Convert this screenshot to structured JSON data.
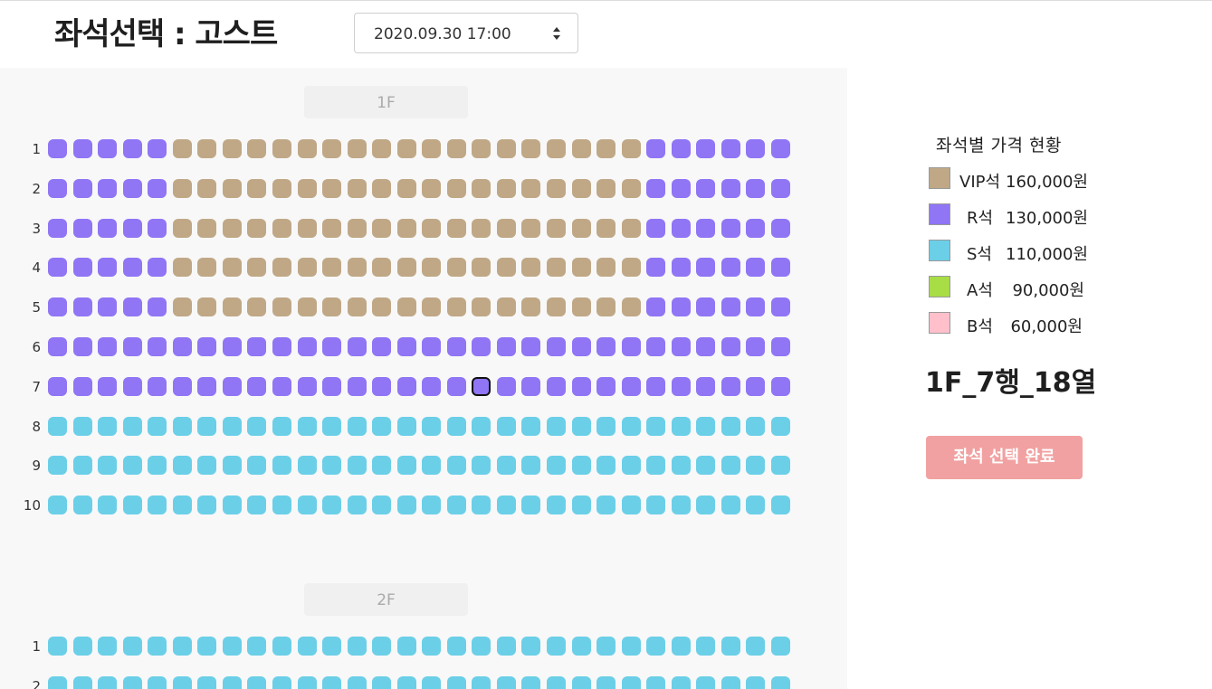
{
  "header": {
    "title": "좌석선택 : 고스트",
    "date_select": {
      "value": "2020.09.30 17:00",
      "icon": "sort-arrows-icon"
    }
  },
  "floors": [
    {
      "label": "1F",
      "rows": [
        {
          "label": "1",
          "seats": "RRRRRVVVVVVVVVVVVVVVVVVVRRRRRR"
        },
        {
          "label": "2",
          "seats": "RRRRRVVVVVVVVVVVVVVVVVVVRRRRRR"
        },
        {
          "label": "3",
          "seats": "RRRRRVVVVVVVVVVVVVVVVVVVRRRRRR"
        },
        {
          "label": "4",
          "seats": "RRRRRVVVVVVVVVVVVVVVVVVVRRRRRR"
        },
        {
          "label": "5",
          "seats": "RRRRRVVVVVVVVVVVVVVVVVVVRRRRRR"
        },
        {
          "label": "6",
          "seats": "RRRRRRRRRRRRRRRRRRRRRRRRRRRRRR"
        },
        {
          "label": "7",
          "seats": "RRRRRRRRRRRRRRRRRRRRRRRRRRRRRR",
          "selected_seat": 18
        },
        {
          "label": "8",
          "seats": "SSSSSSSSSSSSSSSSSSSSSSSSSSSSSS"
        },
        {
          "label": "9",
          "seats": "SSSSSSSSSSSSSSSSSSSSSSSSSSSSSS"
        },
        {
          "label": "10",
          "seats": "SSSSSSSSSSSSSSSSSSSSSSSSSSSSSS"
        }
      ]
    },
    {
      "label": "2F",
      "rows": [
        {
          "label": "1",
          "seats": "SSSSSSSSSSSSSSSSSSSSSSSSSSSSSS"
        },
        {
          "label": "2",
          "seats": "SSSSSSSSSSSSSSSSSSSSSSSSSSSSSS"
        }
      ]
    }
  ],
  "seat_colors": {
    "V": "#c0a886",
    "R": "#9075f5",
    "S": "#6bcfe8",
    "A": "#a8dd45",
    "B": "#ffc0cb"
  },
  "legend": {
    "title": "좌석별 가격 현황",
    "items": [
      {
        "grade": "VIP석",
        "price": "160,000원",
        "color": "#c0a886"
      },
      {
        "grade": "R석",
        "price": "130,000원",
        "color": "#9075f5"
      },
      {
        "grade": "S석",
        "price": "110,000원",
        "color": "#6bcfe8"
      },
      {
        "grade": "A석",
        "price": "90,000원",
        "color": "#a8dd45"
      },
      {
        "grade": "B석",
        "price": "60,000원",
        "color": "#ffc0cb"
      }
    ]
  },
  "selected_seat_text": "1F_7행_18열",
  "complete_button": {
    "label": "좌석 선택 완료",
    "color": "#f1a1a1"
  }
}
